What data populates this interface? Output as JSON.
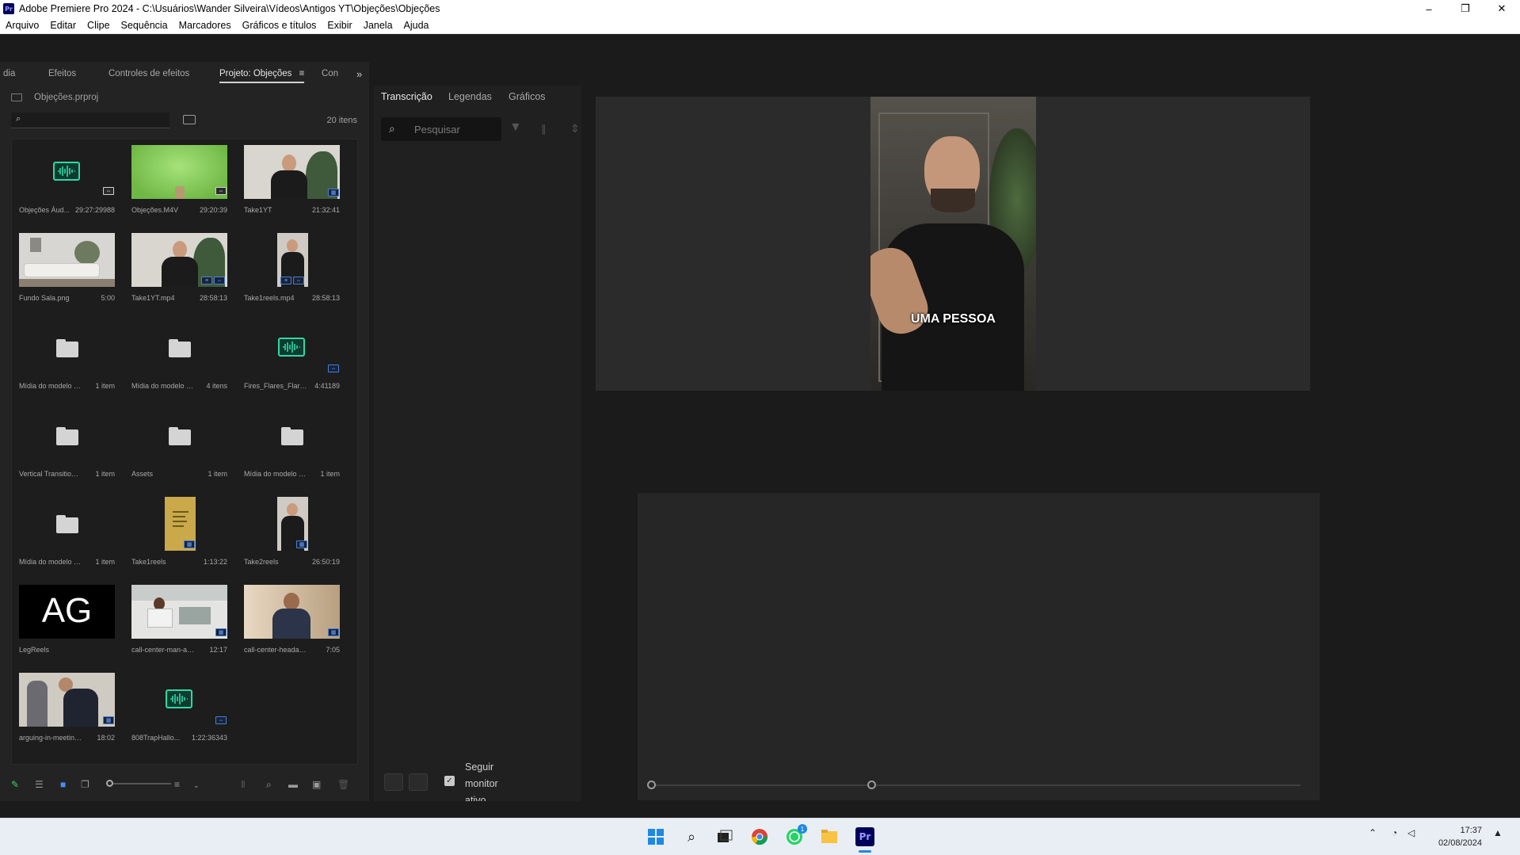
{
  "window": {
    "title": "Adobe Premiere Pro 2024 - C:\\Usuários\\Wander Silveira\\Vídeos\\Antigos YT\\Objeções\\Objeções",
    "logo": "Pr",
    "controls": [
      "minimize",
      "restore",
      "close"
    ]
  },
  "menu": [
    "Arquivo",
    "Editar",
    "Clipe",
    "Sequência",
    "Marcadores",
    "Gráficos e títulos",
    "Exibir",
    "Janela",
    "Ajuda"
  ],
  "project_panel": {
    "tabs": [
      "dia",
      "Efeitos",
      "Controles de efeitos",
      "Projeto: Objeções",
      "Con"
    ],
    "active_tab": "Projeto: Objeções",
    "project_file": "Objeções.prproj",
    "items_count": "20 itens",
    "items": [
      {
        "name": "Objeções Áud...",
        "duration": "29:27:29988",
        "kind": "audio"
      },
      {
        "name": "Objeções.M4V",
        "duration": "29:20:39",
        "kind": "greenscreen"
      },
      {
        "name": "Take1YT",
        "duration": "21:32:41",
        "kind": "video-man"
      },
      {
        "name": "Fundo Sala.png",
        "duration": "5:00",
        "kind": "room"
      },
      {
        "name": "Take1YT.mp4",
        "duration": "28:58:13",
        "kind": "video-man"
      },
      {
        "name": "Take1reels.mp4",
        "duration": "28:58:13",
        "kind": "video-portrait"
      },
      {
        "name": "Mídia do modelo de...",
        "duration": "1 item",
        "kind": "folder"
      },
      {
        "name": "Mídia do modelo de...",
        "duration": "4 itens",
        "kind": "folder"
      },
      {
        "name": "Fires_Flares_Flare...",
        "duration": "4:41189",
        "kind": "audio"
      },
      {
        "name": "Vertical Transitions ...",
        "duration": "1 item",
        "kind": "folder"
      },
      {
        "name": "Assets",
        "duration": "1 item",
        "kind": "folder"
      },
      {
        "name": "Mídia do modelo de...",
        "duration": "1 item",
        "kind": "folder"
      },
      {
        "name": "Mídia do modelo de...",
        "duration": "1 item",
        "kind": "folder"
      },
      {
        "name": "Take1reels",
        "duration": "1:13:22",
        "kind": "yellow-portrait"
      },
      {
        "name": "Take2reels",
        "duration": "26:50:19",
        "kind": "video-portrait"
      },
      {
        "name": "LegReels",
        "duration": "",
        "kind": "ag",
        "thumb_text": "AG"
      },
      {
        "name": "call-center-man-and-...",
        "duration": "12:17",
        "kind": "office"
      },
      {
        "name": "call-center-headache-...",
        "duration": "7:05",
        "kind": "headset"
      },
      {
        "name": "arguing-in-meeting-2...",
        "duration": "18:02",
        "kind": "meeting"
      },
      {
        "name": "808TrapHallo...",
        "duration": "1:22:36343",
        "kind": "audio"
      }
    ]
  },
  "transcript_panel": {
    "tabs": [
      "Transcrição",
      "Legendas",
      "Gráficos"
    ],
    "active_tab": "Transcrição",
    "search_placeholder": "Pesquisar",
    "follow_monitor": {
      "checked": true,
      "label": "Seguir monitor ativo"
    }
  },
  "program_monitor": {
    "caption": "UMA PESSOA"
  },
  "taskbar": {
    "apps": [
      "start-icon",
      "search-icon",
      "task-view-icon",
      "chrome-icon",
      "whatsapp-icon",
      "file-explorer-icon",
      "premiere-icon"
    ],
    "whatsapp_badge": "1",
    "time": "17:37",
    "date": "02/08/2024",
    "premiere_label": "Pr"
  },
  "colors": {
    "accent_audio": "#2ed9a3",
    "badge_blue": "#4a7fd0",
    "panel_bg": "#232323"
  }
}
